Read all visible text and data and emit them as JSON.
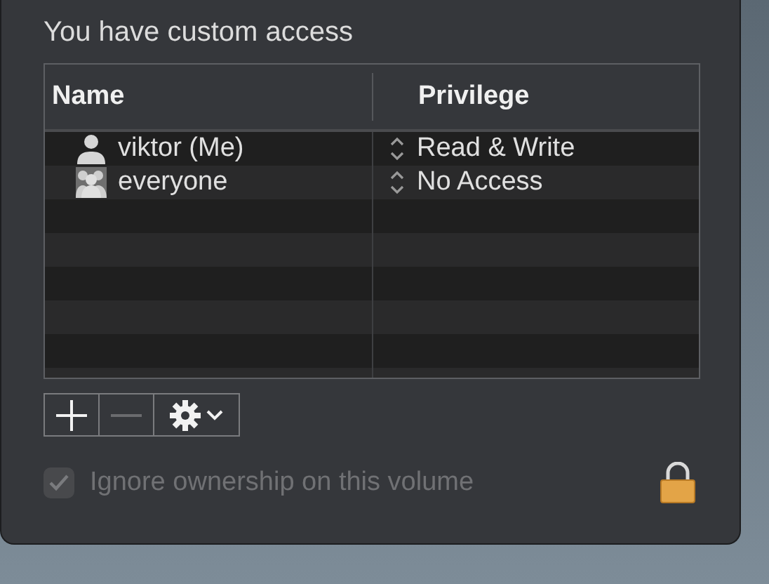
{
  "message": "You have custom access",
  "table": {
    "columns": [
      "Name",
      "Privilege"
    ],
    "rows": [
      {
        "name": "viktor (Me)",
        "kind": "user",
        "privilege": "Read & Write"
      },
      {
        "name": "everyone",
        "kind": "group",
        "privilege": "No Access"
      }
    ]
  },
  "toolbar": [
    {
      "kind": "add",
      "disabled": false
    },
    {
      "kind": "remove",
      "disabled": true
    },
    {
      "kind": "action",
      "disabled": false
    }
  ],
  "ownership": {
    "label": "Ignore ownership on this volume",
    "checked": true,
    "disabled": true
  }
}
